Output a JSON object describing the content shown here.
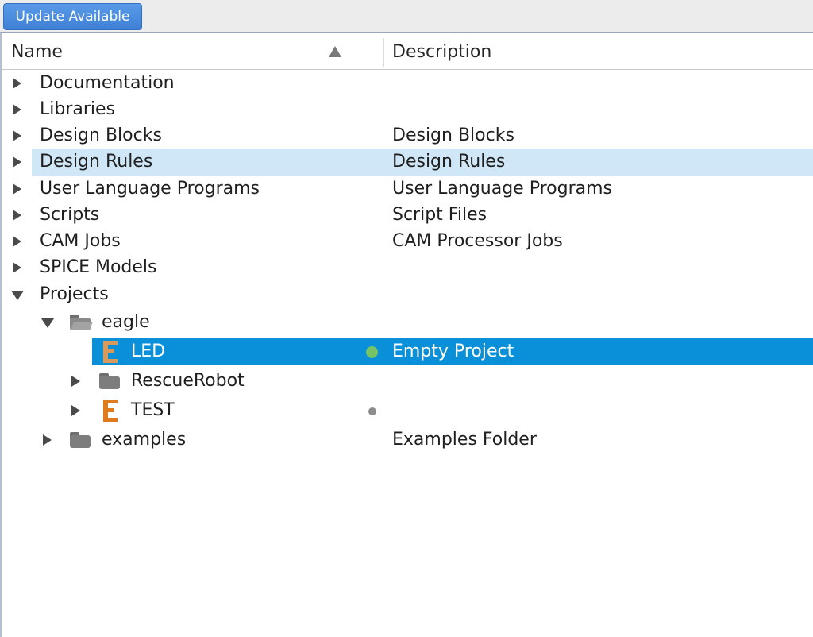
{
  "toolbar": {
    "update_label": "Update Available"
  },
  "header": {
    "name_label": "Name",
    "description_label": "Description"
  },
  "tree": {
    "documentation": {
      "name": "Documentation",
      "description": ""
    },
    "libraries": {
      "name": "Libraries",
      "description": ""
    },
    "design_blocks": {
      "name": "Design Blocks",
      "description": "Design Blocks"
    },
    "design_rules": {
      "name": "Design Rules",
      "description": "Design Rules"
    },
    "ulp": {
      "name": "User Language Programs",
      "description": "User Language Programs"
    },
    "scripts": {
      "name": "Scripts",
      "description": "Script Files"
    },
    "cam_jobs": {
      "name": "CAM Jobs",
      "description": "CAM Processor Jobs"
    },
    "spice_models": {
      "name": "SPICE Models",
      "description": ""
    },
    "projects": {
      "name": "Projects",
      "description": ""
    },
    "eagle": {
      "name": "eagle",
      "description": ""
    },
    "led": {
      "name": "LED",
      "description": "Empty Project"
    },
    "rescue_robot": {
      "name": "RescueRobot",
      "description": ""
    },
    "test": {
      "name": "TEST",
      "description": ""
    },
    "examples": {
      "name": "examples",
      "description": "Examples Folder"
    }
  },
  "colors": {
    "selection_strong": "#0a8fd9",
    "selection_light": "#cfe7f6",
    "eagle_icon_led": "#d79a5a",
    "eagle_icon_test": "#e07a1f",
    "status_active": "#76c267",
    "status_inactive": "#8c8c8c"
  },
  "icons": {
    "collapsed": "triangle-right",
    "expanded": "triangle-down",
    "sort": "triangle-up",
    "folder": "folder-icon",
    "folder_open": "folder-open-icon",
    "eagle_project": "eagle-e-icon"
  }
}
